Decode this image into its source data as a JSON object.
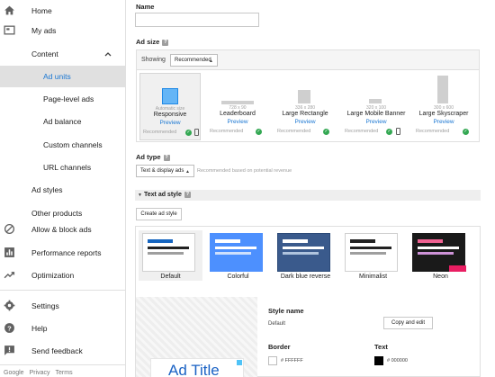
{
  "sidebar": {
    "items": [
      {
        "label": "Home"
      },
      {
        "label": "My ads"
      },
      {
        "label": "Content"
      },
      {
        "label": "Ad units"
      },
      {
        "label": "Page-level ads"
      },
      {
        "label": "Ad balance"
      },
      {
        "label": "Custom channels"
      },
      {
        "label": "URL channels"
      },
      {
        "label": "Ad styles"
      },
      {
        "label": "Other products"
      },
      {
        "label": "Allow & block ads"
      },
      {
        "label": "Performance reports"
      },
      {
        "label": "Optimization"
      },
      {
        "label": "Settings"
      },
      {
        "label": "Help"
      },
      {
        "label": "Send feedback"
      }
    ],
    "footer": [
      "Google",
      "Privacy",
      "Terms"
    ]
  },
  "form": {
    "name_label": "Name",
    "name_value": "",
    "ad_size_label": "Ad size",
    "showing_label": "Showing",
    "showing_value": "Recommended",
    "sizes": [
      {
        "dims": "Automatic size",
        "title": "Responsive",
        "preview": "Preview",
        "rec": "Recommended"
      },
      {
        "dims": "728 x 90",
        "title": "Leaderboard",
        "preview": "Preview",
        "rec": "Recommended"
      },
      {
        "dims": "336 x 280",
        "title": "Large Rectangle",
        "preview": "Preview",
        "rec": "Recommended"
      },
      {
        "dims": "320 x 100",
        "title": "Large Mobile Banner",
        "preview": "Preview",
        "rec": "Recommended"
      },
      {
        "dims": "300 x 600",
        "title": "Large Skyscraper",
        "preview": "Preview",
        "rec": "Recommended"
      }
    ],
    "ad_type_label": "Ad type",
    "ad_type_value": "Text & display ads",
    "ad_type_note": "Recommended based on potential revenue",
    "text_ad_style_label": "Text ad style",
    "create_style_button": "Create ad style",
    "styles": [
      {
        "name": "Default"
      },
      {
        "name": "Colorful"
      },
      {
        "name": "Dark blue reverse"
      },
      {
        "name": "Minimalist"
      },
      {
        "name": "Neon"
      }
    ],
    "style_name_label": "Style name",
    "style_name_value": "Default",
    "copy_edit_button": "Copy and edit",
    "border_label": "Border",
    "border_hex": "# FFFFFF",
    "text_label": "Text",
    "text_hex": "# 000000",
    "preview_ad_title": "Ad Title"
  },
  "colors": {
    "accent": "#1976d2",
    "selected_bg": "#e0e0e0",
    "ok_green": "#34a853"
  }
}
